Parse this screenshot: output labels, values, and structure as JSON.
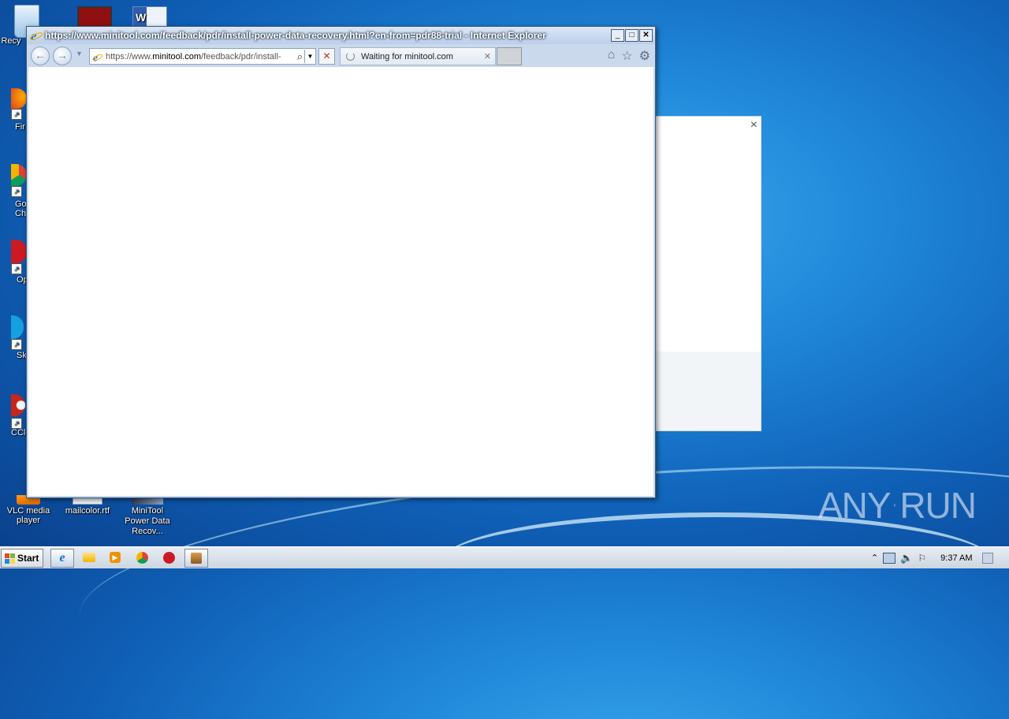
{
  "desktop": {
    "icons": [
      {
        "name": "recycle-bin",
        "label": "Recy"
      },
      {
        "name": "firefox",
        "label": "Fir"
      },
      {
        "name": "chrome",
        "label": "Go\nChr"
      },
      {
        "name": "opera",
        "label": "Op"
      },
      {
        "name": "skype",
        "label": "Sk"
      },
      {
        "name": "ccleaner",
        "label": "CCle"
      },
      {
        "name": "vlc",
        "label": "VLC media player"
      },
      {
        "name": "mailcolor",
        "label": "mailcolor.rtf"
      },
      {
        "name": "minitool",
        "label": "MiniTool Power Data Recov..."
      }
    ]
  },
  "ie": {
    "window_title": "https://www.minitool.com/feedback/pdr/install-power-data-recovery.html?en-from=pdr88-trial - Internet Explorer",
    "address_prefix": "https://www.",
    "address_domain": "minitool.com",
    "address_suffix": "/feedback/pdr/install-",
    "tab_title": "Waiting for minitool.com",
    "minimize": "_",
    "maximize": "□",
    "close": "✕",
    "stop": "✕",
    "tab_close": "✕"
  },
  "background_dialog": {
    "close": "×"
  },
  "taskbar": {
    "start_label": "Start",
    "clock": "9:37 AM"
  },
  "watermark": {
    "left": "ANY",
    "right": "RUN"
  },
  "colors": {
    "desktop": "#1f86d8",
    "taskbar": "#dde3ea",
    "ie_frame": "#cad9ec"
  }
}
